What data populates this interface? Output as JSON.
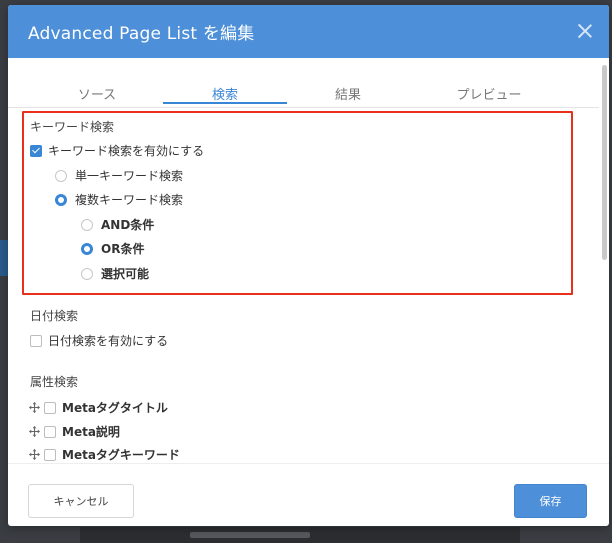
{
  "dialog": {
    "title": "Advanced Page List を編集"
  },
  "tabs": [
    {
      "label": "ソース",
      "active": false
    },
    {
      "label": "検索",
      "active": true
    },
    {
      "label": "結果",
      "active": false
    },
    {
      "label": "プレビュー",
      "active": false
    }
  ],
  "keyword_search": {
    "section_title": "キーワード検索",
    "enable_label": "キーワード検索を有効にする",
    "enabled": true,
    "single_label": "単一キーワード検索",
    "multiple_label": "複数キーワード検索",
    "mode_selected": "multiple",
    "and_label": "AND条件",
    "or_label": "OR条件",
    "selectable_label": "選択可能",
    "condition_selected": "or"
  },
  "date_search": {
    "section_title": "日付検索",
    "enable_label": "日付検索を有効にする",
    "enabled": false
  },
  "attribute_search": {
    "section_title": "属性検索",
    "items": [
      {
        "label": "Metaタグタイトル",
        "checked": false
      },
      {
        "label": "Meta説明",
        "checked": false
      },
      {
        "label": "Metaタグキーワード",
        "checked": false
      }
    ]
  },
  "footer": {
    "cancel_label": "キャンセル",
    "save_label": "保存"
  },
  "colors": {
    "accent": "#4d8fd8",
    "highlight_annotation": "#e8301c"
  }
}
